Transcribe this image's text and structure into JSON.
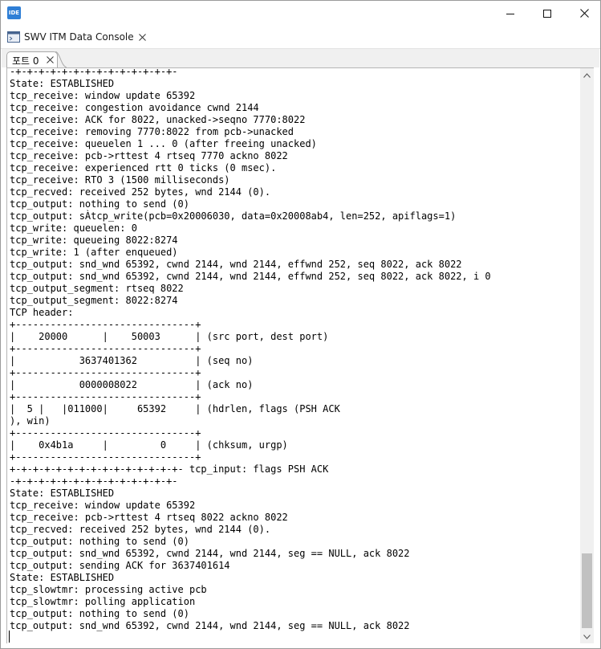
{
  "window": {
    "app_icon_text": "IDE"
  },
  "view": {
    "title": "SWV ITM Data Console"
  },
  "console_tab": {
    "label": "포트 0"
  },
  "console": {
    "scroll_position_percent": 90,
    "lines": [
      "-+-+-+-+-+-+-+-+-+-+-+-+-+-+-",
      "State: ESTABLISHED",
      "tcp_receive: window update 65392",
      "tcp_receive: congestion avoidance cwnd 2144",
      "tcp_receive: ACK for 8022, unacked->seqno 7770:8022",
      "tcp_receive: removing 7770:8022 from pcb->unacked",
      "tcp_receive: queuelen 1 ... 0 (after freeing unacked)",
      "tcp_receive: pcb->rttest 4 rtseq 7770 ackno 8022",
      "tcp_receive: experienced rtt 0 ticks (0 msec).",
      "tcp_receive: RTO 3 (1500 milliseconds)",
      "tcp_recved: received 252 bytes, wnd 2144 (0).",
      "tcp_output: nothing to send (0)",
      "tcp_output: sÀtcp_write(pcb=0x20006030, data=0x20008ab4, len=252, apiflags=1)",
      "tcp_write: queuelen: 0",
      "tcp_write: queueing 8022:8274",
      "tcp_write: 1 (after enqueued)",
      "tcp_output: snd_wnd 65392, cwnd 2144, wnd 2144, effwnd 252, seq 8022, ack 8022",
      "tcp_output: snd_wnd 65392, cwnd 2144, wnd 2144, effwnd 252, seq 8022, ack 8022, i 0",
      "tcp_output_segment: rtseq 8022",
      "tcp_output_segment: 8022:8274",
      "TCP header:",
      "+-------------------------------+",
      "|    20000      |    50003      | (src port, dest port)",
      "+-------------------------------+",
      "|           3637401362          | (seq no)",
      "+-------------------------------+",
      "|           0000008022          | (ack no)",
      "+-------------------------------+",
      "|  5 |   |011000|     65392     | (hdrlen, flags (PSH ACK",
      "), win)",
      "+-------------------------------+",
      "|    0x4b1a     |         0     | (chksum, urgp)",
      "+-------------------------------+",
      "+-+-+-+-+-+-+-+-+-+-+-+-+-+-+- tcp_input: flags PSH ACK",
      "-+-+-+-+-+-+-+-+-+-+-+-+-+-+-",
      "State: ESTABLISHED",
      "tcp_receive: window update 65392",
      "tcp_receive: pcb->rttest 4 rtseq 8022 ackno 8022",
      "tcp_recved: received 252 bytes, wnd 2144 (0).",
      "tcp_output: nothing to send (0)",
      "tcp_output: snd_wnd 65392, cwnd 2144, wnd 2144, seg == NULL, ack 8022",
      "tcp_output: sending ACK for 3637401614",
      "State: ESTABLISHED",
      "tcp_slowtmr: processing active pcb",
      "tcp_slowtmr: polling application",
      "tcp_output: nothing to send (0)",
      "tcp_output: snd_wnd 65392, cwnd 2144, wnd 2144, seg == NULL, ack 8022"
    ]
  },
  "colors": {
    "app_icon": "#2f7fd6",
    "remove_icon": "#d9262c",
    "add_icon": "#3ba33b",
    "scrollbar_thumb": "#c1c1c1"
  }
}
